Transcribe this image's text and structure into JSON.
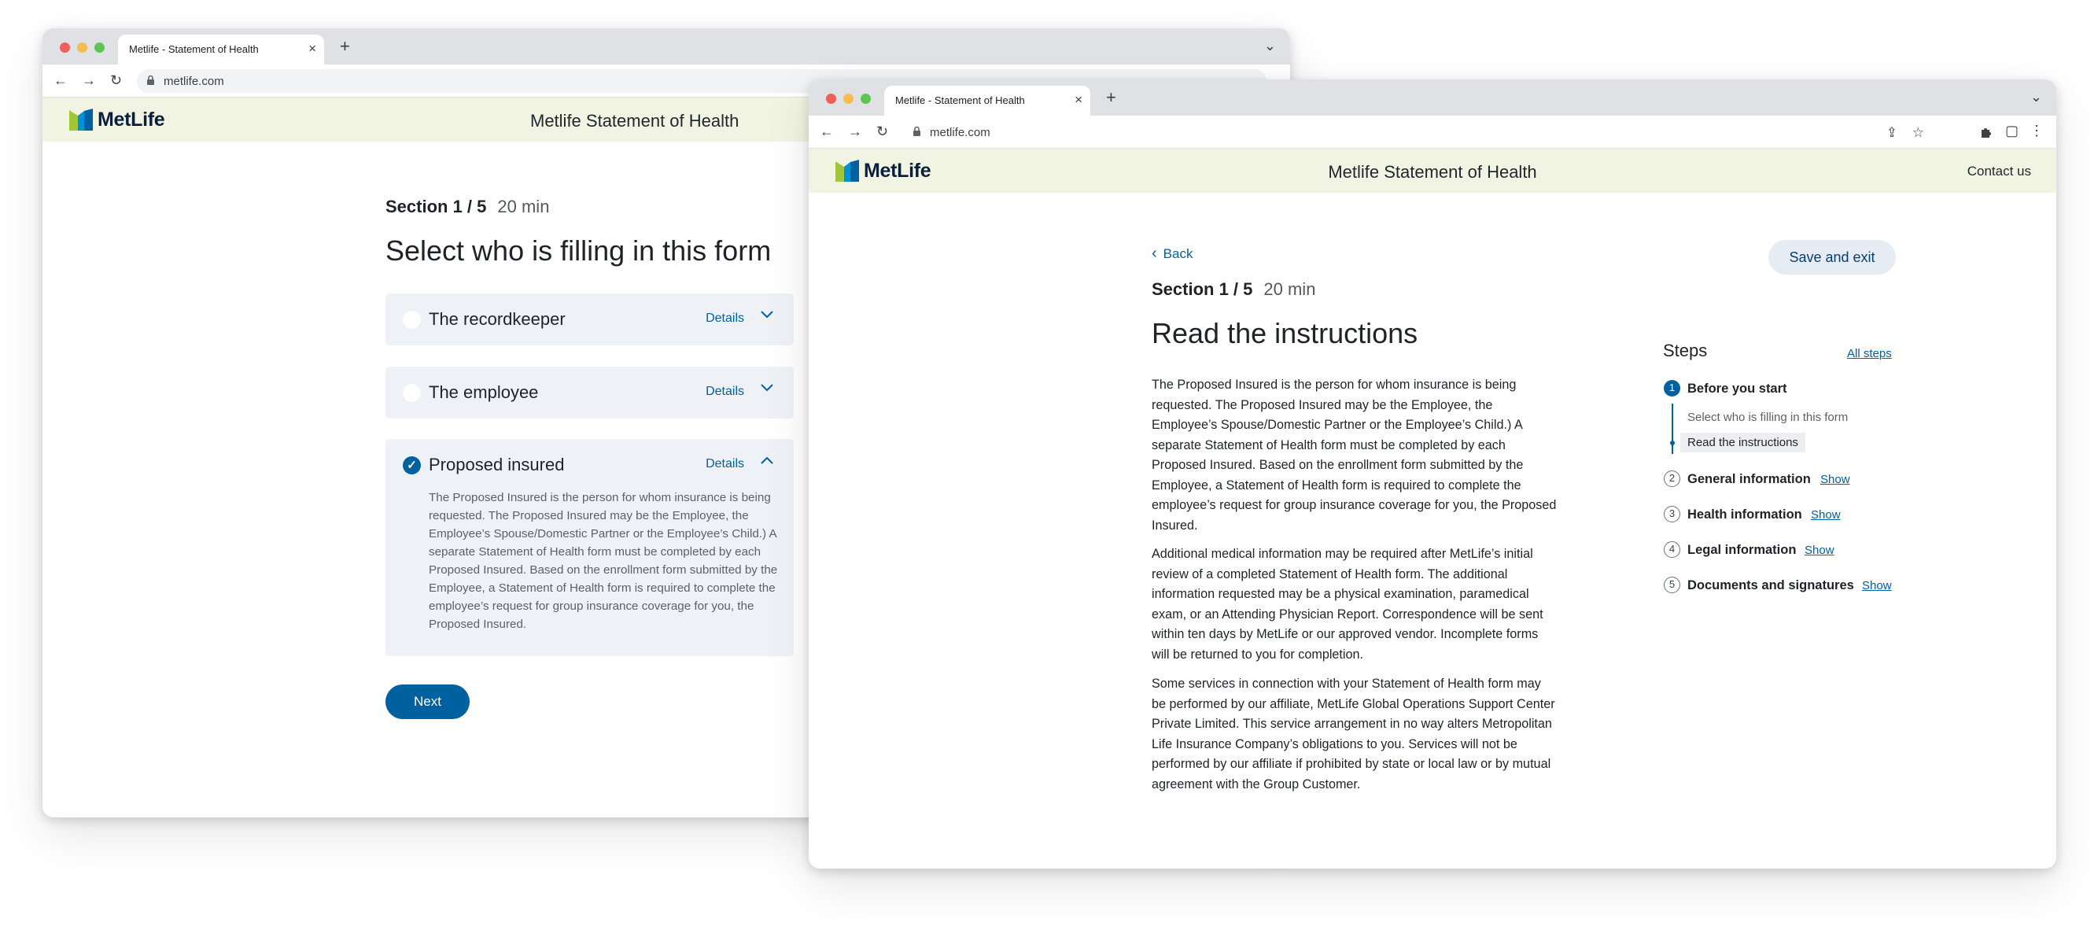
{
  "windows": {
    "back": {
      "tab_title": "Metlife - Statement of Health",
      "url": "metlife.com",
      "logo_text": "MetLife",
      "site_title": "Metlife Statement of Health",
      "section": "Section 1 / 5",
      "duration": "20 min",
      "heading": "Select who is filling in this form",
      "options": [
        {
          "label": "The recordkeeper",
          "details": "Details",
          "selected": false,
          "expanded": false
        },
        {
          "label": "The employee",
          "details": "Details",
          "selected": false,
          "expanded": false
        },
        {
          "label": "Proposed insured",
          "details": "Details",
          "selected": true,
          "expanded": true,
          "body": "The Proposed Insured is the person for whom insurance is being requested. The Proposed Insured may be the Employee, the Employee’s Spouse/Domestic Partner or the Employee’s Child.) A separate Statement of Health form must be completed by each Proposed Insured. Based on the enrollment form submitted by the Employee, a Statement of Health form is required to complete the employee’s request for group insurance coverage for you, the Proposed Insured."
        }
      ],
      "next_label": "Next"
    },
    "front": {
      "tab_title": "Metlife - Statement of Health",
      "url": "metlife.com",
      "logo_text": "MetLife",
      "site_title": "Metlife Statement of Health",
      "contact": "Contact us",
      "back_label": "Back",
      "save_exit": "Save and exit",
      "section": "Section 1 / 5",
      "duration": "20 min",
      "heading": "Read the instructions",
      "paragraphs": [
        "The Proposed Insured is the person for whom insurance is being requested. The Proposed Insured may be the Employee, the Employee’s Spouse/Domestic Partner or the Employee’s Child.) A separate Statement of Health form must be completed by each Proposed Insured. Based on the enrollment form submitted by the Employee, a Statement of Health form is required to complete the employee’s request for group insurance coverage for you, the Proposed Insured.",
        "Additional medical information may be required after MetLife’s initial review of a completed Statement of Health form. The additional information requested may be a physical examination, paramedical exam, or an Attending Physician Report. Correspondence will be sent within ten days by MetLife or our approved vendor. Incomplete forms will be returned to you for completion.",
        "Some services in connection with your Statement of Health form may be performed by our affiliate, MetLife Global Operations Support Center Private Limited. This service arrangement in no way alters Metropolitan Life Insurance Company’s obligations to you. Services will not be performed by our affiliate if prohibited by state or local law or by mutual agreement with the Group Customer."
      ],
      "steps": {
        "title": "Steps",
        "all_steps": "All steps",
        "items": [
          {
            "num": "1",
            "title": "Before you start",
            "show": "",
            "active": true,
            "sub": [
              "Select who is filling in this form",
              "Read the instructions"
            ]
          },
          {
            "num": "2",
            "title": "General information",
            "show": "Show",
            "active": false
          },
          {
            "num": "3",
            "title": "Health information",
            "show": "Show",
            "active": false
          },
          {
            "num": "4",
            "title": "Legal information",
            "show": "Show",
            "active": false
          },
          {
            "num": "5",
            "title": "Documents and signatures",
            "show": "Show",
            "active": false
          }
        ]
      }
    }
  },
  "icons": {
    "back_arrow": "←",
    "forward_arrow": "→",
    "reload": "↻",
    "close": "×",
    "new_tab": "+",
    "share": "⇪",
    "star": "☆",
    "extensions": "puzzle",
    "sidepanel": "▢",
    "kebab": "⋮",
    "tabs_menu": "⌄",
    "chevron_left": "‹"
  },
  "colors": {
    "brand_blue": "#0061a0",
    "logo_green": "#a3c639",
    "logo_blue": "#0090da",
    "header_bg": "#f2f4e3"
  }
}
